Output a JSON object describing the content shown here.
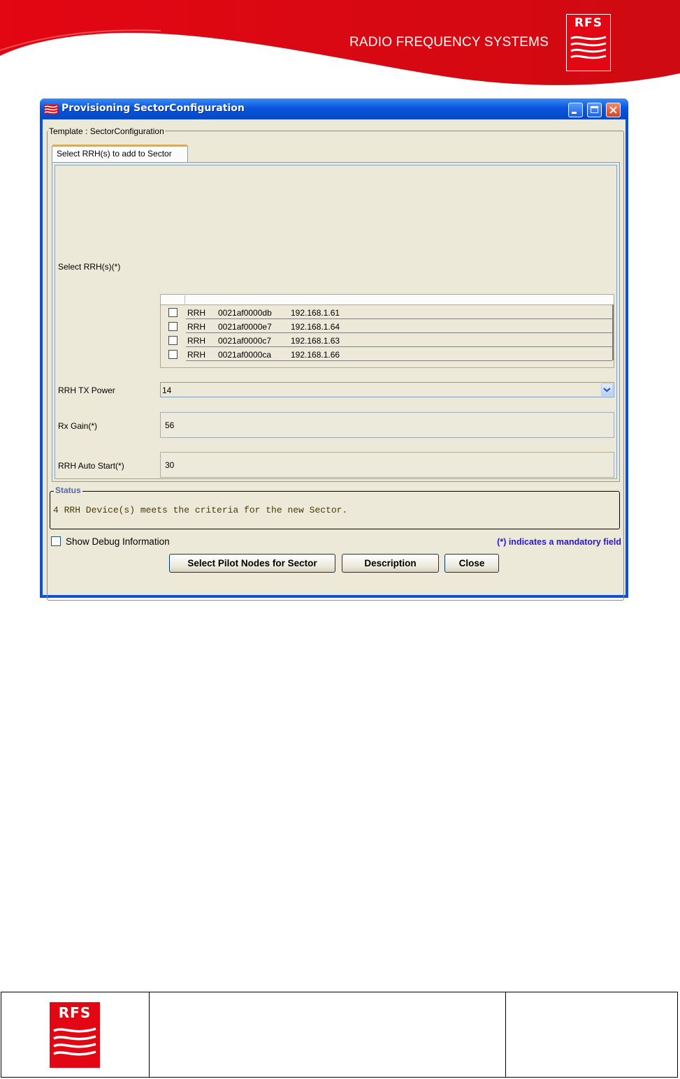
{
  "header": {
    "company_name": "RADIO FREQUENCY SYSTEMS",
    "logo_text": "RFS"
  },
  "window": {
    "title": "Provisioning SectorConfiguration",
    "template_legend": "Template : SectorConfiguration",
    "tab_label": "Select RRH(s) to add to Sector",
    "fields": {
      "select_rrh_label": "Select RRH(s)(*)",
      "tx_power_label": "RRH TX Power",
      "tx_power_value": "14",
      "rx_gain_label": "Rx Gain(*)",
      "rx_gain_value": "56",
      "auto_start_label": "RRH Auto Start(*)",
      "auto_start_value": "30"
    },
    "rrh_rows": [
      {
        "type": "RRH",
        "id": "0021af0000db",
        "ip": "192.168.1.61",
        "checked": false
      },
      {
        "type": "RRH",
        "id": "0021af0000e7",
        "ip": "192.168.1.64",
        "checked": false
      },
      {
        "type": "RRH",
        "id": "0021af0000c7",
        "ip": "192.168.1.63",
        "checked": false
      },
      {
        "type": "RRH",
        "id": "0021af0000ca",
        "ip": "192.168.1.66",
        "checked": false
      }
    ],
    "status": {
      "legend": "Status",
      "message": "4 RRH Device(s) meets the criteria for the new Sector."
    },
    "debug_label": "Show Debug Information",
    "mandatory_note": "(*) indicates a mandatory field",
    "buttons": {
      "select_pilot": "Select Pilot Nodes for Sector",
      "description": "Description",
      "close": "Close"
    }
  },
  "footer": {
    "logo_text": "RFS"
  },
  "colors": {
    "brand_red": "#e30613",
    "title_bar_blue": "#0a55df",
    "mandatory_blue": "#2a14d8"
  }
}
